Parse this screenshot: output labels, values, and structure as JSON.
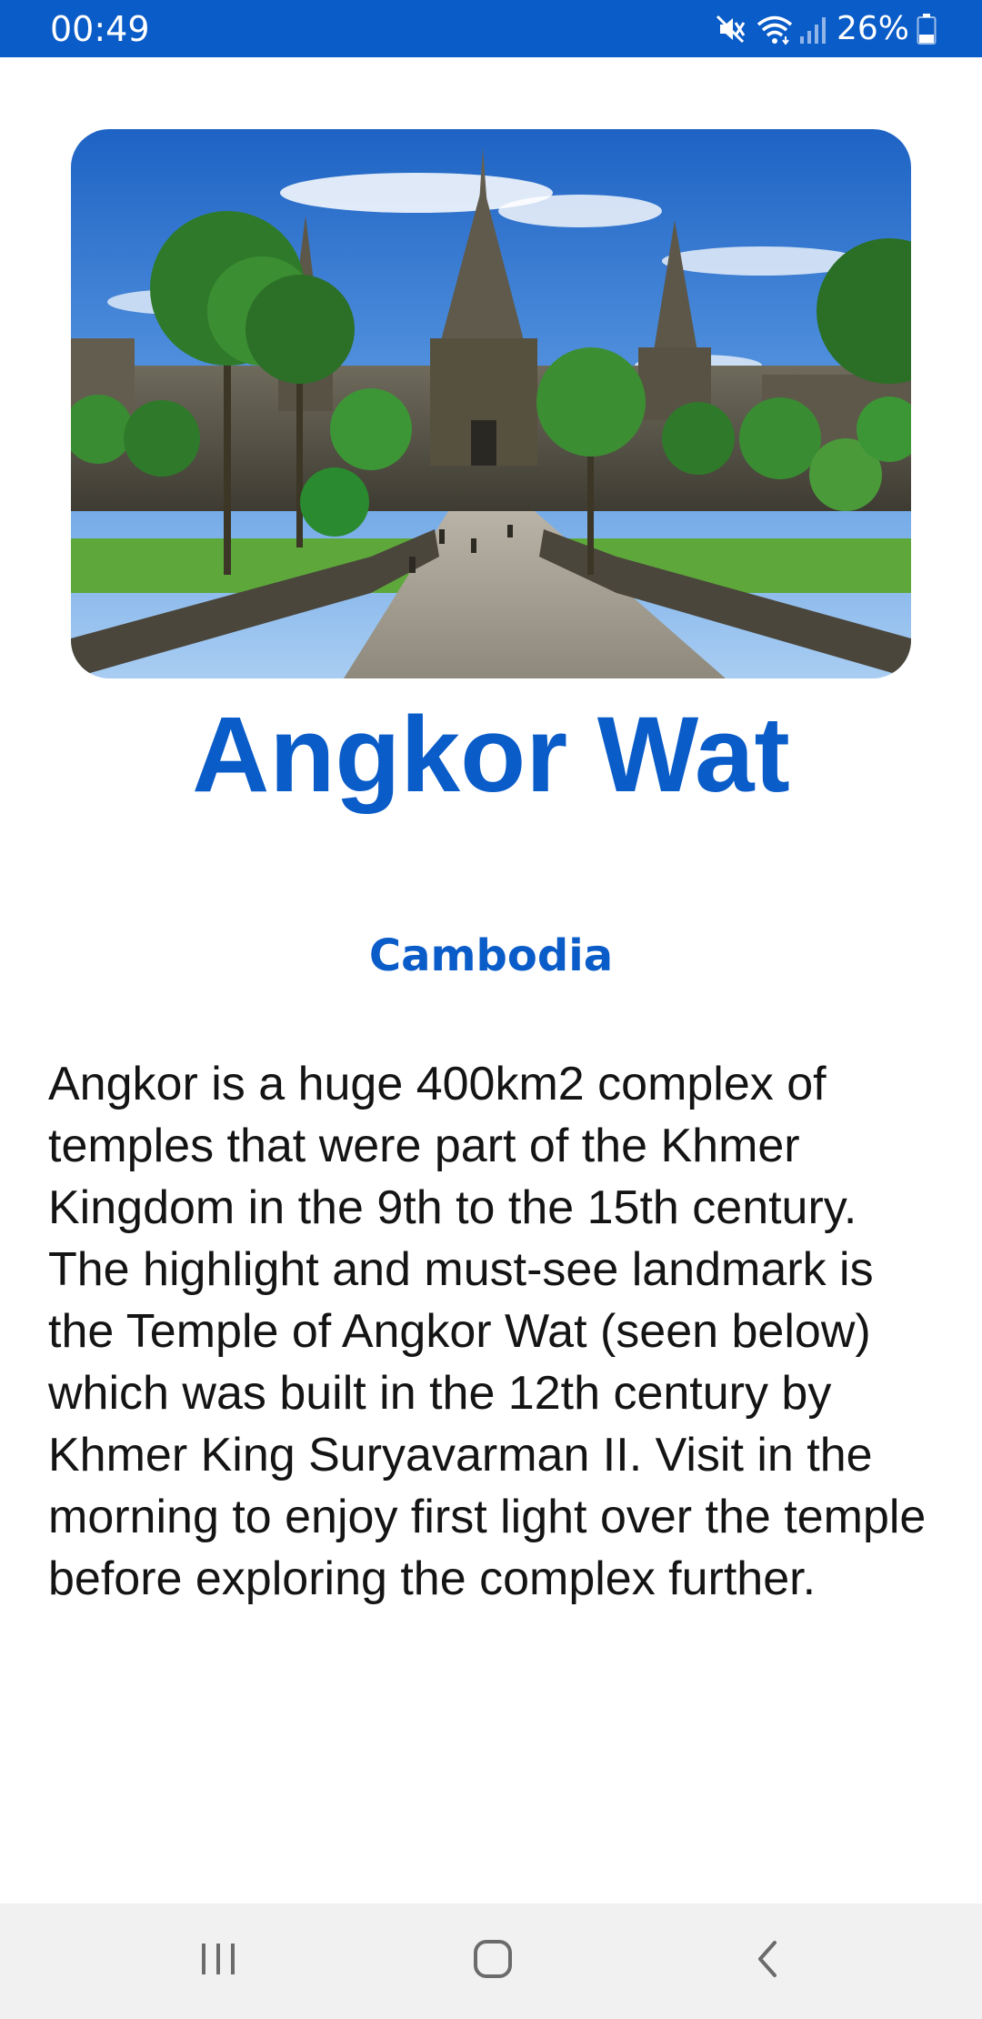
{
  "status_bar": {
    "time": "00:49",
    "battery_percent": "26%",
    "icons": [
      "mute-icon",
      "wifi-icon",
      "signal-icon",
      "battery-icon"
    ],
    "background": "#0a5cc8"
  },
  "hero_image": {
    "subject": "Angkor Wat temple with palm trees and stone causeway"
  },
  "place": {
    "title": "Angkor Wat",
    "country": "Cambodia",
    "description": "Angkor is a huge 400km2 complex of temples that were part of the Khmer Kingdom in the 9th to the 15th century. The highlight and must-see landmark is the Temple of Angkor Wat (seen below) which was built in the 12th century by Khmer King Suryavarman II. Visit in the morning to enjoy first light over the temple before exploring the complex further."
  },
  "nav_bar": {
    "buttons": [
      "recent-apps-icon",
      "home-icon",
      "back-icon"
    ]
  },
  "colors": {
    "accent": "#0a5cc8",
    "text": "#141414",
    "nav_background": "#f1f1f1"
  }
}
